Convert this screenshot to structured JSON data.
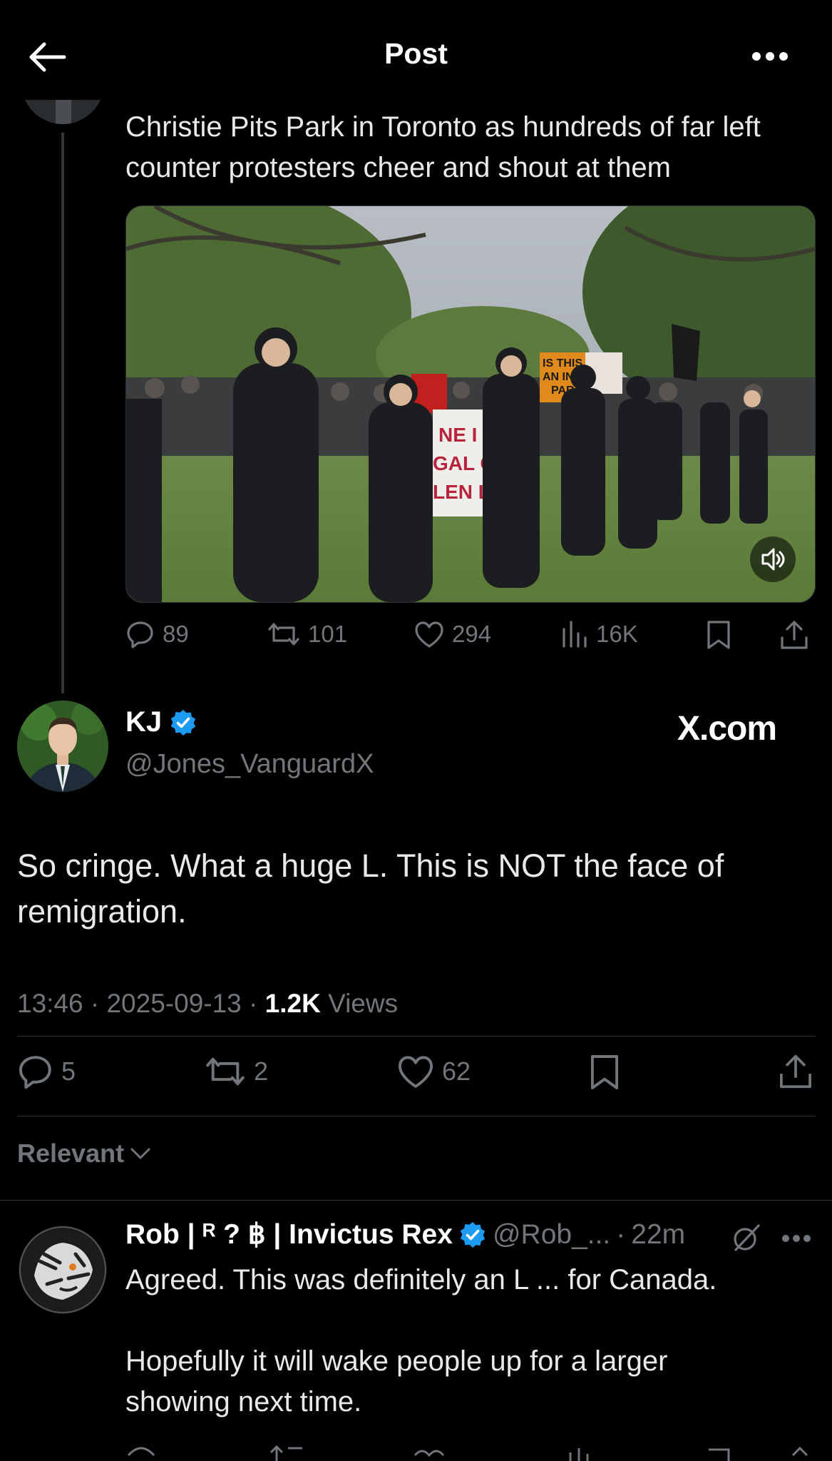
{
  "header": {
    "title": "Post"
  },
  "prev_post": {
    "text_partial": "Christie Pits Park in Toronto as hundreds of far left counter protesters cheer and shout at them",
    "media": {
      "sign_left_lines": [
        "NE I",
        "GAL O",
        "LEN LAN"
      ],
      "sign_right_lines": [
        "IS THIS",
        "AN INCH",
        "PAR"
      ]
    },
    "stats": {
      "replies": "89",
      "reposts": "101",
      "likes": "294",
      "views": "16K"
    }
  },
  "main_post": {
    "author_name": "KJ",
    "handle": "@Jones_VanguardX",
    "source_label": "X.com",
    "text_line1": "So cringe. What a huge L. This is NOT the face of",
    "text_line2": "remigration.",
    "time": "13:46",
    "sep": "·",
    "date": "2025-09-13",
    "views_count": "1.2K",
    "views_label": "Views",
    "stats": {
      "replies": "5",
      "reposts": "2",
      "likes": "62"
    }
  },
  "filter": {
    "label": "Relevant"
  },
  "reply": {
    "name": "Rob | ᴿ ? ฿ | Invictus Rex",
    "handle": "@Rob_...",
    "dot": "·",
    "time": "22m",
    "text_line1": "Agreed.  This was definitely an L ... for Canada.",
    "text_line2": "Hopefully it will wake people up for a larger",
    "text_line3": "showing next time."
  },
  "colors": {
    "background": "#000000",
    "text": "#e7e9ea",
    "muted": "#71767b",
    "verified": "#1d9bf0",
    "divider": "#2f3336"
  }
}
